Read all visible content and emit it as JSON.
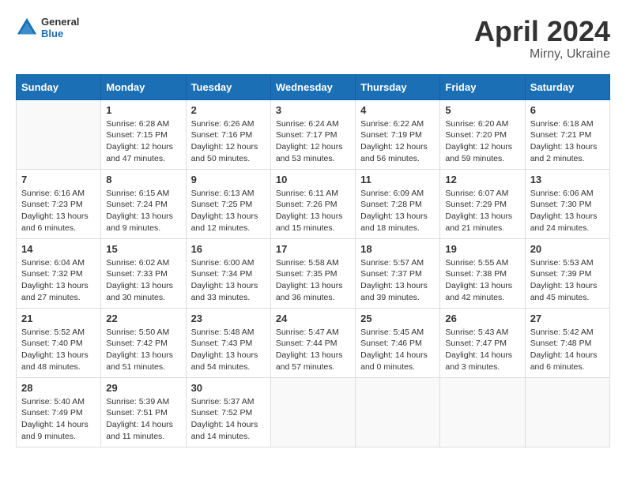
{
  "header": {
    "logo_general": "General",
    "logo_blue": "Blue",
    "month_title": "April 2024",
    "location": "Mirny, Ukraine"
  },
  "weekdays": [
    "Sunday",
    "Monday",
    "Tuesday",
    "Wednesday",
    "Thursday",
    "Friday",
    "Saturday"
  ],
  "weeks": [
    [
      {
        "day": "",
        "sunrise": "",
        "sunset": "",
        "daylight": ""
      },
      {
        "day": "1",
        "sunrise": "Sunrise: 6:28 AM",
        "sunset": "Sunset: 7:15 PM",
        "daylight": "Daylight: 12 hours and 47 minutes."
      },
      {
        "day": "2",
        "sunrise": "Sunrise: 6:26 AM",
        "sunset": "Sunset: 7:16 PM",
        "daylight": "Daylight: 12 hours and 50 minutes."
      },
      {
        "day": "3",
        "sunrise": "Sunrise: 6:24 AM",
        "sunset": "Sunset: 7:17 PM",
        "daylight": "Daylight: 12 hours and 53 minutes."
      },
      {
        "day": "4",
        "sunrise": "Sunrise: 6:22 AM",
        "sunset": "Sunset: 7:19 PM",
        "daylight": "Daylight: 12 hours and 56 minutes."
      },
      {
        "day": "5",
        "sunrise": "Sunrise: 6:20 AM",
        "sunset": "Sunset: 7:20 PM",
        "daylight": "Daylight: 12 hours and 59 minutes."
      },
      {
        "day": "6",
        "sunrise": "Sunrise: 6:18 AM",
        "sunset": "Sunset: 7:21 PM",
        "daylight": "Daylight: 13 hours and 2 minutes."
      }
    ],
    [
      {
        "day": "7",
        "sunrise": "Sunrise: 6:16 AM",
        "sunset": "Sunset: 7:23 PM",
        "daylight": "Daylight: 13 hours and 6 minutes."
      },
      {
        "day": "8",
        "sunrise": "Sunrise: 6:15 AM",
        "sunset": "Sunset: 7:24 PM",
        "daylight": "Daylight: 13 hours and 9 minutes."
      },
      {
        "day": "9",
        "sunrise": "Sunrise: 6:13 AM",
        "sunset": "Sunset: 7:25 PM",
        "daylight": "Daylight: 13 hours and 12 minutes."
      },
      {
        "day": "10",
        "sunrise": "Sunrise: 6:11 AM",
        "sunset": "Sunset: 7:26 PM",
        "daylight": "Daylight: 13 hours and 15 minutes."
      },
      {
        "day": "11",
        "sunrise": "Sunrise: 6:09 AM",
        "sunset": "Sunset: 7:28 PM",
        "daylight": "Daylight: 13 hours and 18 minutes."
      },
      {
        "day": "12",
        "sunrise": "Sunrise: 6:07 AM",
        "sunset": "Sunset: 7:29 PM",
        "daylight": "Daylight: 13 hours and 21 minutes."
      },
      {
        "day": "13",
        "sunrise": "Sunrise: 6:06 AM",
        "sunset": "Sunset: 7:30 PM",
        "daylight": "Daylight: 13 hours and 24 minutes."
      }
    ],
    [
      {
        "day": "14",
        "sunrise": "Sunrise: 6:04 AM",
        "sunset": "Sunset: 7:32 PM",
        "daylight": "Daylight: 13 hours and 27 minutes."
      },
      {
        "day": "15",
        "sunrise": "Sunrise: 6:02 AM",
        "sunset": "Sunset: 7:33 PM",
        "daylight": "Daylight: 13 hours and 30 minutes."
      },
      {
        "day": "16",
        "sunrise": "Sunrise: 6:00 AM",
        "sunset": "Sunset: 7:34 PM",
        "daylight": "Daylight: 13 hours and 33 minutes."
      },
      {
        "day": "17",
        "sunrise": "Sunrise: 5:58 AM",
        "sunset": "Sunset: 7:35 PM",
        "daylight": "Daylight: 13 hours and 36 minutes."
      },
      {
        "day": "18",
        "sunrise": "Sunrise: 5:57 AM",
        "sunset": "Sunset: 7:37 PM",
        "daylight": "Daylight: 13 hours and 39 minutes."
      },
      {
        "day": "19",
        "sunrise": "Sunrise: 5:55 AM",
        "sunset": "Sunset: 7:38 PM",
        "daylight": "Daylight: 13 hours and 42 minutes."
      },
      {
        "day": "20",
        "sunrise": "Sunrise: 5:53 AM",
        "sunset": "Sunset: 7:39 PM",
        "daylight": "Daylight: 13 hours and 45 minutes."
      }
    ],
    [
      {
        "day": "21",
        "sunrise": "Sunrise: 5:52 AM",
        "sunset": "Sunset: 7:40 PM",
        "daylight": "Daylight: 13 hours and 48 minutes."
      },
      {
        "day": "22",
        "sunrise": "Sunrise: 5:50 AM",
        "sunset": "Sunset: 7:42 PM",
        "daylight": "Daylight: 13 hours and 51 minutes."
      },
      {
        "day": "23",
        "sunrise": "Sunrise: 5:48 AM",
        "sunset": "Sunset: 7:43 PM",
        "daylight": "Daylight: 13 hours and 54 minutes."
      },
      {
        "day": "24",
        "sunrise": "Sunrise: 5:47 AM",
        "sunset": "Sunset: 7:44 PM",
        "daylight": "Daylight: 13 hours and 57 minutes."
      },
      {
        "day": "25",
        "sunrise": "Sunrise: 5:45 AM",
        "sunset": "Sunset: 7:46 PM",
        "daylight": "Daylight: 14 hours and 0 minutes."
      },
      {
        "day": "26",
        "sunrise": "Sunrise: 5:43 AM",
        "sunset": "Sunset: 7:47 PM",
        "daylight": "Daylight: 14 hours and 3 minutes."
      },
      {
        "day": "27",
        "sunrise": "Sunrise: 5:42 AM",
        "sunset": "Sunset: 7:48 PM",
        "daylight": "Daylight: 14 hours and 6 minutes."
      }
    ],
    [
      {
        "day": "28",
        "sunrise": "Sunrise: 5:40 AM",
        "sunset": "Sunset: 7:49 PM",
        "daylight": "Daylight: 14 hours and 9 minutes."
      },
      {
        "day": "29",
        "sunrise": "Sunrise: 5:39 AM",
        "sunset": "Sunset: 7:51 PM",
        "daylight": "Daylight: 14 hours and 11 minutes."
      },
      {
        "day": "30",
        "sunrise": "Sunrise: 5:37 AM",
        "sunset": "Sunset: 7:52 PM",
        "daylight": "Daylight: 14 hours and 14 minutes."
      },
      {
        "day": "",
        "sunrise": "",
        "sunset": "",
        "daylight": ""
      },
      {
        "day": "",
        "sunrise": "",
        "sunset": "",
        "daylight": ""
      },
      {
        "day": "",
        "sunrise": "",
        "sunset": "",
        "daylight": ""
      },
      {
        "day": "",
        "sunrise": "",
        "sunset": "",
        "daylight": ""
      }
    ]
  ]
}
